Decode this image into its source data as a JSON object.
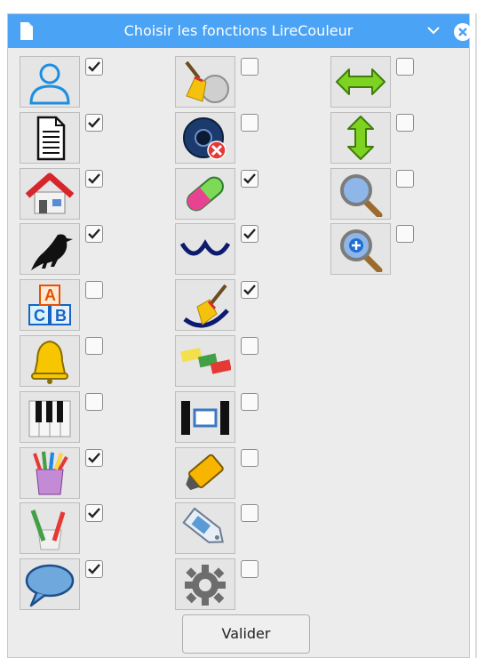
{
  "window": {
    "title": "Choisir les fonctions LireCouleur"
  },
  "functions": [
    {
      "icon": "user-icon",
      "checked": true
    },
    {
      "icon": "document-icon",
      "checked": true
    },
    {
      "icon": "house-icon",
      "checked": true
    },
    {
      "icon": "blackbird-icon",
      "checked": true
    },
    {
      "icon": "abc-blocks-icon",
      "checked": false
    },
    {
      "icon": "bell-icon",
      "checked": false
    },
    {
      "icon": "piano-keys-icon",
      "checked": false
    },
    {
      "icon": "colored-pencils-icon",
      "checked": true
    },
    {
      "icon": "pencils-icon",
      "checked": true
    },
    {
      "icon": "speech-bubble-icon",
      "checked": true
    },
    {
      "icon": "broom-icon",
      "checked": false
    },
    {
      "icon": "mute-speaker-icon",
      "checked": false
    },
    {
      "icon": "pill-icon",
      "checked": true
    },
    {
      "icon": "arcs-icon",
      "checked": true
    },
    {
      "icon": "broom-arc-icon",
      "checked": true
    },
    {
      "icon": "color-blocks-icon",
      "checked": false
    },
    {
      "icon": "space-frame-icon",
      "checked": false
    },
    {
      "icon": "highlighter-icon",
      "checked": false
    },
    {
      "icon": "tag-icon",
      "checked": false
    },
    {
      "icon": "gear-icon",
      "checked": false
    },
    {
      "icon": "horizontal-arrows-icon",
      "checked": false
    },
    {
      "icon": "vertical-arrows-icon",
      "checked": false
    },
    {
      "icon": "magnifier-icon",
      "checked": false
    },
    {
      "icon": "zoom-in-icon",
      "checked": false
    }
  ],
  "buttons": {
    "validate_label": "Valider"
  }
}
